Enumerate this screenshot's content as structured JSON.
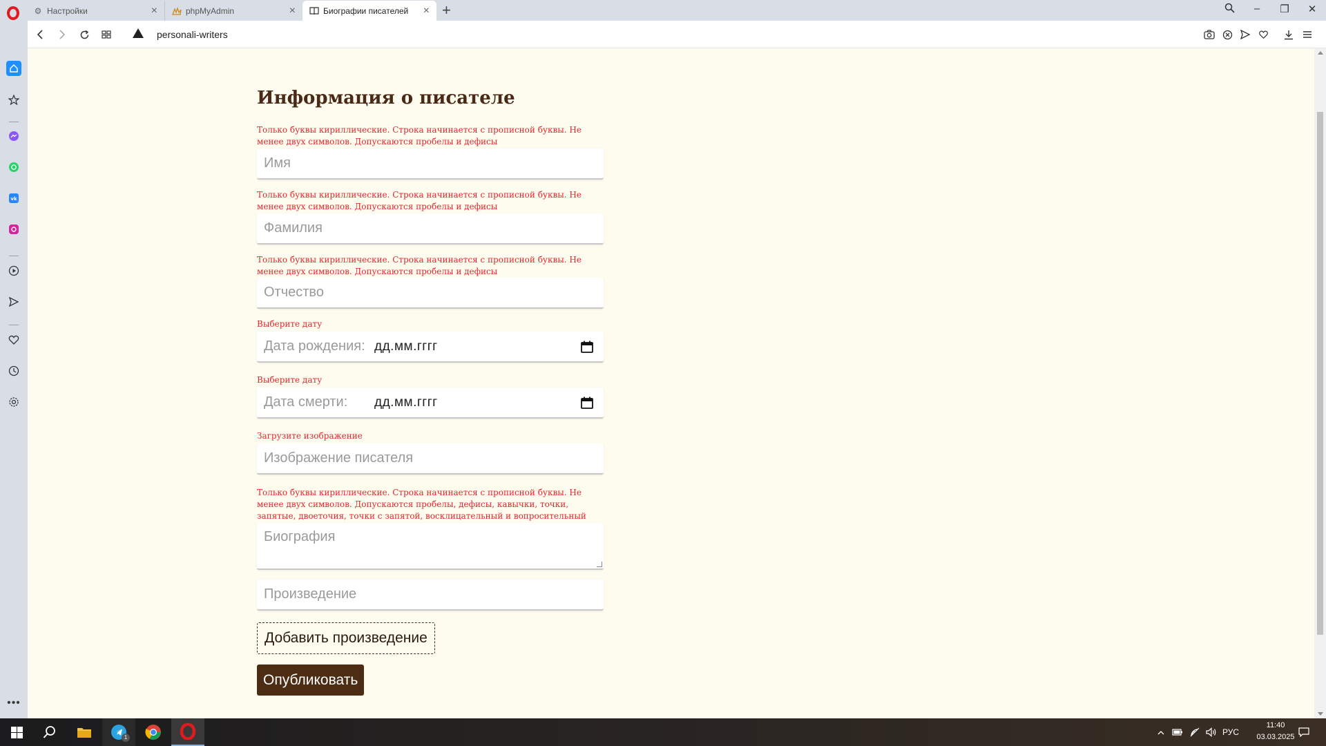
{
  "browser": {
    "tabs": [
      {
        "title": "Настройки",
        "icon": "gear-icon"
      },
      {
        "title": "phpMyAdmin",
        "icon": "phpmyadmin-icon"
      },
      {
        "title": "Биографии писателей",
        "icon": "book-icon",
        "active": true
      }
    ],
    "address": "personali-writers",
    "accent_color": "#e11920"
  },
  "form": {
    "title": "Информация о писателе",
    "hint_name": "Только буквы кириллические. Строка начинается с прописной буквы. Не менее двух символов. Допускаются пробелы и дефисы",
    "name_placeholder": "Имя",
    "hint_surname": "Только буквы кириллические. Строка начинается с прописной буквы. Не менее двух символов. Допускаются пробелы и дефисы",
    "surname_placeholder": "Фамилия",
    "hint_patronymic": "Только буквы кириллические. Строка начинается с прописной буквы. Не менее двух символов. Допускаются пробелы и дефисы",
    "patronymic_placeholder": "Отчество",
    "hint_birth": "Выберите дату",
    "birth_label": "Дата рождения:",
    "birth_value": "дд.мм.гггг",
    "hint_death": "Выберите дату",
    "death_label": "Дата смерти:",
    "death_value": "дд.мм.гггг",
    "hint_image": "Загрузите изображение",
    "image_placeholder": "Изображение писателя",
    "hint_bio": "Только буквы кириллические. Строка начинается с прописной буквы. Не менее двух символов. Допускаются пробелы, дефисы, кавычки, точки, запятые, двоеточия, точки с запятой, восклицательный и вопросительный знак",
    "bio_placeholder": "Биография",
    "work_placeholder": "Произведение",
    "add_work_label": "Добавить произведение",
    "publish_label": "Опубликовать",
    "colors": {
      "hint": "#e3262e",
      "title": "#4a2a16",
      "publish_bg": "#4d2c14",
      "page_bg": "#fdfcef"
    }
  },
  "taskbar": {
    "language": "РУС",
    "time": "11:40",
    "date": "03.03.2025",
    "telegram_badge": "1"
  }
}
